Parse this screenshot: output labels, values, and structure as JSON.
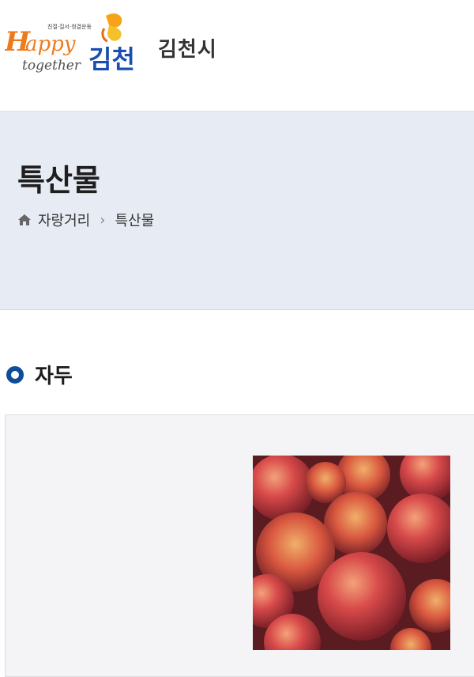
{
  "header": {
    "logo": {
      "tagline": "Happy",
      "together": "together",
      "kim": "김천",
      "small_text": "친절·질서·청결운동"
    },
    "city_name": "김천시"
  },
  "hero": {
    "title": "특산물",
    "breadcrumb": [
      "자랑거리",
      "특산물"
    ]
  },
  "section": {
    "title": "자두"
  },
  "icons": {
    "home": "home-icon",
    "separator": "chevron-right-icon",
    "section_marker": "ring-icon"
  },
  "colors": {
    "hero_bg": "#e7ebf3",
    "accent_blue": "#0f4d9a",
    "logo_orange": "#f08a1c",
    "card_bg": "#f4f4f6"
  }
}
